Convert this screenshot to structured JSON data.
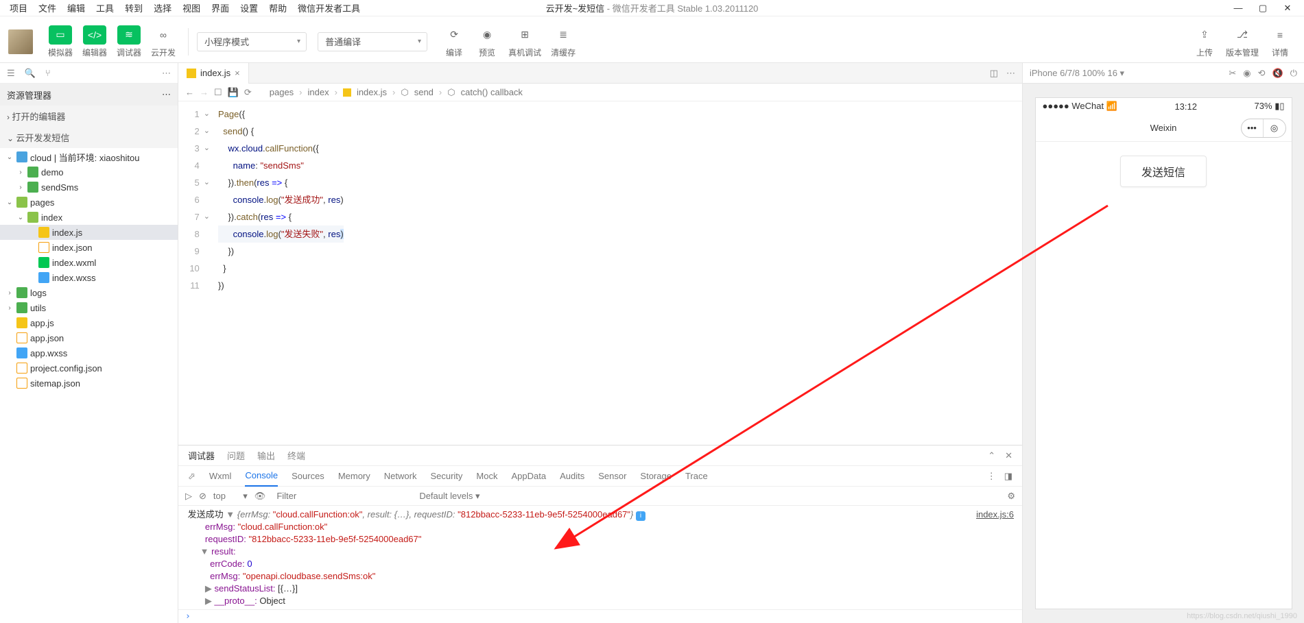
{
  "menu": [
    "项目",
    "文件",
    "编辑",
    "工具",
    "转到",
    "选择",
    "视图",
    "界面",
    "设置",
    "帮助",
    "微信开发者工具"
  ],
  "title_main": "云开发~发短信",
  "title_sub": " - 微信开发者工具 Stable 1.03.2011120",
  "toolbar": {
    "simulator": "模拟器",
    "editor": "编辑器",
    "debugger": "调试器",
    "cloud": "云开发",
    "mode": "小程序模式",
    "compile": "普通编译",
    "compile_lbl": "编译",
    "preview_lbl": "预览",
    "remote_lbl": "真机调试",
    "cache_lbl": "清缓存",
    "upload_lbl": "上传",
    "version_lbl": "版本管理",
    "detail_lbl": "详情"
  },
  "sidebar": {
    "title": "资源管理器",
    "open_editors": "打开的编辑器",
    "project": "云开发发短信",
    "tree": [
      {
        "l": 0,
        "exp": true,
        "icon": "cloud",
        "label": "cloud | 当前环境: xiaoshitou"
      },
      {
        "l": 1,
        "exp": false,
        "icon": "folder",
        "label": "demo"
      },
      {
        "l": 1,
        "exp": false,
        "icon": "folder",
        "label": "sendSms"
      },
      {
        "l": 0,
        "exp": true,
        "icon": "folder-o",
        "label": "pages"
      },
      {
        "l": 1,
        "exp": true,
        "icon": "folder-o",
        "label": "index"
      },
      {
        "l": 2,
        "exp": null,
        "icon": "js",
        "label": "index.js",
        "sel": true
      },
      {
        "l": 2,
        "exp": null,
        "icon": "json",
        "label": "index.json"
      },
      {
        "l": 2,
        "exp": null,
        "icon": "wxml",
        "label": "index.wxml"
      },
      {
        "l": 2,
        "exp": null,
        "icon": "wxss",
        "label": "index.wxss"
      },
      {
        "l": 0,
        "exp": false,
        "icon": "folder",
        "label": "logs"
      },
      {
        "l": 0,
        "exp": false,
        "icon": "folder",
        "label": "utils"
      },
      {
        "l": 0,
        "exp": null,
        "icon": "js",
        "label": "app.js"
      },
      {
        "l": 0,
        "exp": null,
        "icon": "json",
        "label": "app.json"
      },
      {
        "l": 0,
        "exp": null,
        "icon": "wxss",
        "label": "app.wxss"
      },
      {
        "l": 0,
        "exp": null,
        "icon": "json",
        "label": "project.config.json"
      },
      {
        "l": 0,
        "exp": null,
        "icon": "json",
        "label": "sitemap.json"
      }
    ]
  },
  "editor": {
    "tab": "index.js",
    "crumbs": [
      "pages",
      "index",
      "index.js",
      "send",
      "catch() callback"
    ],
    "str1": "\"sendSms\"",
    "str2": "\"发送成功\"",
    "str3": "\"发送失败\""
  },
  "panel": {
    "tabs": [
      "调试器",
      "问题",
      "输出",
      "终端"
    ],
    "devtabs": [
      "Wxml",
      "Console",
      "Sources",
      "Memory",
      "Network",
      "Security",
      "Mock",
      "AppData",
      "Audits",
      "Sensor",
      "Storage",
      "Trace"
    ],
    "scope": "top",
    "filter_ph": "Filter",
    "levels": "Default levels ▾",
    "link": "index.js:6"
  },
  "console": {
    "prefix": "发送成功",
    "summary_errMsg": "\"cloud.callFunction:ok\"",
    "summary_requestID": "\"812bbacc-5233-11eb-9e5f-5254000ead67\"",
    "errMsg_k": "errMsg:",
    "errMsg_v": "\"cloud.callFunction:ok\"",
    "requestID_k": "requestID:",
    "requestID_v": "\"812bbacc-5233-11eb-9e5f-5254000ead67\"",
    "result_k": "result:",
    "errCode_k": "errCode:",
    "errCode_v": "0",
    "errMsg2_k": "errMsg:",
    "errMsg2_v": "\"openapi.cloudbase.sendSms:ok\"",
    "sendStatus_k": "sendStatusList:",
    "sendStatus_v": "[{…}]",
    "proto_k": "__proto__:",
    "proto_v": "Object"
  },
  "sim": {
    "device": "iPhone 6/7/8 100% 16 ▾",
    "signal": "●●●●● WeChat",
    "time": "13:12",
    "battery": "73%",
    "navtitle": "Weixin",
    "button": "发送短信"
  },
  "watermark": "https://blog.csdn.net/qiushi_1990"
}
